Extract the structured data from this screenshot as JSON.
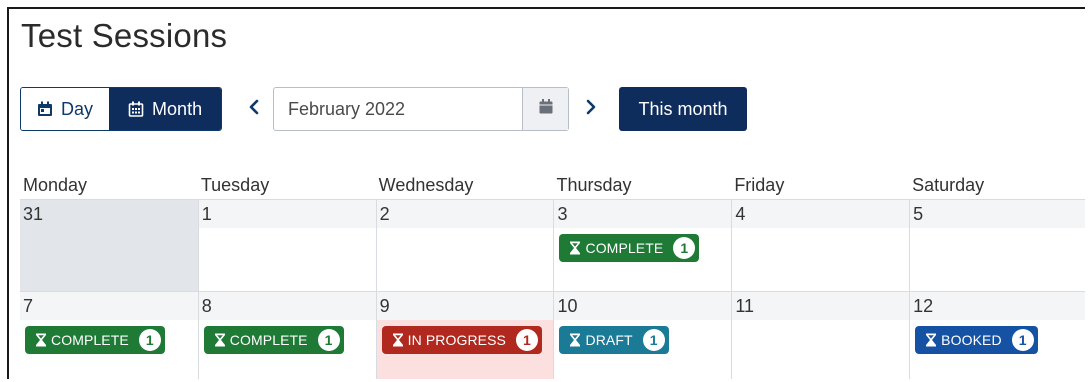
{
  "page": {
    "title": "Test Sessions"
  },
  "toolbar": {
    "day_label": "Day",
    "month_label": "Month",
    "date_value": "February 2022",
    "this_month_label": "This month"
  },
  "calendar": {
    "weekdays": [
      "Monday",
      "Tuesday",
      "Wednesday",
      "Thursday",
      "Friday",
      "Saturday"
    ],
    "weeks": [
      [
        {
          "day": "31"
        },
        {
          "day": "1"
        },
        {
          "day": "2"
        },
        {
          "day": "3",
          "badge": {
            "status": "COMPLETE",
            "count": "1"
          }
        },
        {
          "day": "4"
        },
        {
          "day": "5"
        }
      ],
      [
        {
          "day": "7",
          "badge": {
            "status": "COMPLETE",
            "count": "1"
          }
        },
        {
          "day": "8",
          "badge": {
            "status": "COMPLETE",
            "count": "1"
          }
        },
        {
          "day": "9",
          "badge": {
            "status": "IN PROGRESS",
            "count": "1"
          }
        },
        {
          "day": "10",
          "badge": {
            "status": "DRAFT",
            "count": "1"
          }
        },
        {
          "day": "11"
        },
        {
          "day": "12",
          "badge": {
            "status": "BOOKED",
            "count": "1"
          }
        }
      ]
    ]
  },
  "colors": {
    "primary": "#0e2d5c",
    "complete": "#1e7a35",
    "in_progress": "#b0281e",
    "draft": "#1b7a96",
    "booked": "#1652a3",
    "today_bg": "#fbe0df"
  },
  "icons": {
    "day": "calendar-day-icon",
    "month": "calendar-grid-icon",
    "prev": "chevron-left-icon",
    "next": "chevron-right-icon",
    "picker": "calendar-icon",
    "status": "hourglass-icon"
  }
}
